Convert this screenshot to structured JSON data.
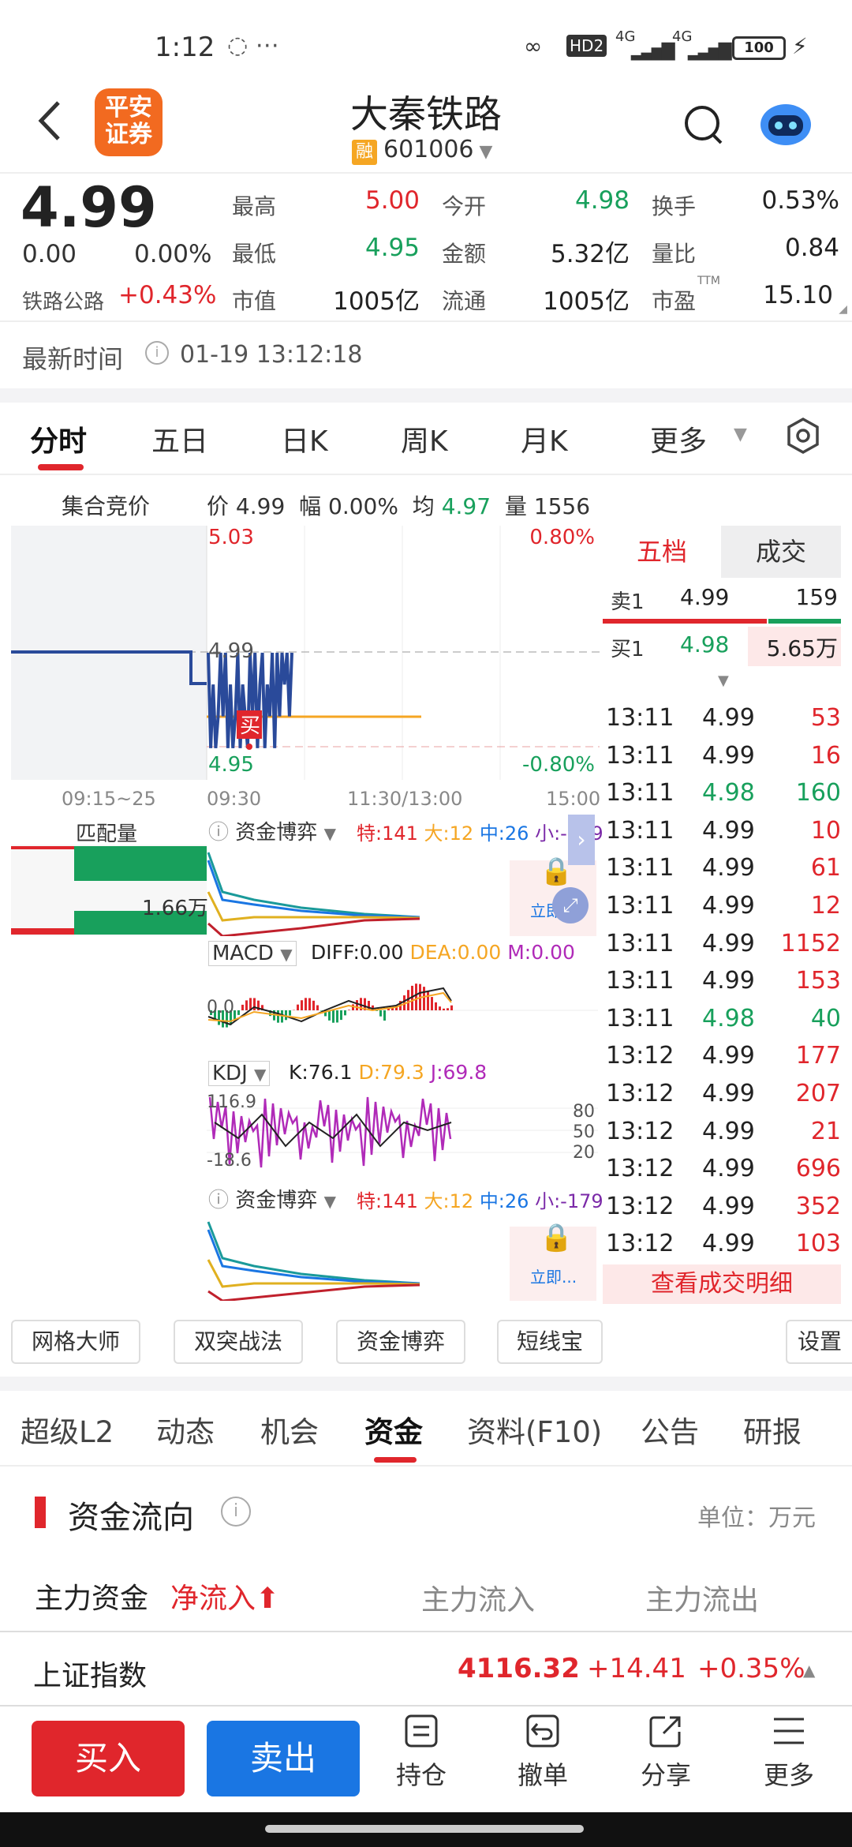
{
  "status": {
    "time": "1:12",
    "sig1": "4G",
    "sig2": "4G",
    "battery": "100",
    "hd": "HD2"
  },
  "header": {
    "title": "大秦铁路",
    "code": "601006",
    "rong": "融",
    "logo_line1": "平安",
    "logo_line2": "证券"
  },
  "quote": {
    "price": "4.99",
    "change": "0.00",
    "change_pct": "0.00%",
    "sector": "铁路公路",
    "sector_pct": "+0.43%",
    "high_label": "最高",
    "high": "5.00",
    "open_label": "今开",
    "open": "4.98",
    "turnover_label": "换手",
    "turnover": "0.53%",
    "low_label": "最低",
    "low": "4.95",
    "amount_label": "金额",
    "amount": "5.32亿",
    "volratio_label": "量比",
    "volratio": "0.84",
    "mcap_label": "市值",
    "mcap": "1005亿",
    "float_label": "流通",
    "float": "1005亿",
    "pe_label": "市盈",
    "pe_sup": "TTM",
    "pe": "15.10"
  },
  "updated": {
    "label": "最新时间",
    "value": "01-19 13:12:18"
  },
  "charttabs": [
    "分时",
    "五日",
    "日K",
    "周K",
    "月K",
    "更多"
  ],
  "infobar": {
    "auction": "集合竞价",
    "price_label": "价",
    "price": "4.99",
    "amp_label": "幅",
    "amp": "0.00%",
    "avg_label": "均",
    "avg": "4.97",
    "vol_label": "量",
    "vol": "1556"
  },
  "chart_data": {
    "type": "line",
    "title": "",
    "x_ticks": [
      "09:15~25",
      "09:30",
      "11:30/13:00",
      "15:00"
    ],
    "ylim": [
      4.95,
      5.03
    ],
    "y_top": "5.03",
    "y_bottom": "4.95",
    "pct_top": "0.80%",
    "pct_bottom": "-0.80%",
    "prev_close": "4.99",
    "series": [
      {
        "name": "",
        "values": [
          4.99,
          4.96,
          4.98,
          4.96,
          4.97,
          4.99,
          4.97,
          4.99,
          4.96,
          4.98,
          4.96,
          4.97,
          4.99,
          4.96,
          4.98,
          4.97,
          4.96,
          4.99,
          4.97,
          4.99,
          4.96,
          4.98,
          4.99,
          4.96,
          4.98,
          4.97,
          4.99,
          4.96,
          4.99,
          4.97,
          4.99,
          4.98,
          4.99,
          4.97,
          4.99
        ]
      }
    ]
  },
  "buy_marker": "买",
  "match_label": "匹配量",
  "match_value": "1.66万",
  "ind1": {
    "name": "资金博弈",
    "te": "特:141",
    "da": "大:12",
    "zhong": "中:26",
    "xiao": "小:-179",
    "lock": "立即..."
  },
  "macd": {
    "name": "MACD",
    "diff": "DIFF:0.00",
    "dea": "DEA:0.00",
    "m": "M:0.00",
    "zero": "0.0"
  },
  "kdj": {
    "name": "KDJ",
    "k": "K:76.1",
    "d": "D:79.3",
    "j": "J:69.8",
    "l80": "80",
    "l50": "50",
    "l20": "20",
    "top": "116.9",
    "bot": "-18.6"
  },
  "orderbook": {
    "tab1": "五档",
    "tab2": "成交",
    "sell1_label": "卖1",
    "sell1_price": "4.99",
    "sell1_vol": "159",
    "buy1_label": "买1",
    "buy1_price": "4.98",
    "buy1_vol": "5.65万"
  },
  "trades": [
    {
      "t": "13:11",
      "p": "4.99",
      "v": "53",
      "pc": "b",
      "vc": "r"
    },
    {
      "t": "13:11",
      "p": "4.99",
      "v": "16",
      "pc": "b",
      "vc": "r"
    },
    {
      "t": "13:11",
      "p": "4.98",
      "v": "160",
      "pc": "g",
      "vc": "g"
    },
    {
      "t": "13:11",
      "p": "4.99",
      "v": "10",
      "pc": "b",
      "vc": "r"
    },
    {
      "t": "13:11",
      "p": "4.99",
      "v": "61",
      "pc": "b",
      "vc": "r"
    },
    {
      "t": "13:11",
      "p": "4.99",
      "v": "12",
      "pc": "b",
      "vc": "r"
    },
    {
      "t": "13:11",
      "p": "4.99",
      "v": "1152",
      "pc": "b",
      "vc": "r"
    },
    {
      "t": "13:11",
      "p": "4.99",
      "v": "153",
      "pc": "b",
      "vc": "r"
    },
    {
      "t": "13:11",
      "p": "4.98",
      "v": "40",
      "pc": "g",
      "vc": "g"
    },
    {
      "t": "13:12",
      "p": "4.99",
      "v": "177",
      "pc": "b",
      "vc": "r"
    },
    {
      "t": "13:12",
      "p": "4.99",
      "v": "207",
      "pc": "b",
      "vc": "r"
    },
    {
      "t": "13:12",
      "p": "4.99",
      "v": "21",
      "pc": "b",
      "vc": "r"
    },
    {
      "t": "13:12",
      "p": "4.99",
      "v": "696",
      "pc": "b",
      "vc": "r"
    },
    {
      "t": "13:12",
      "p": "4.99",
      "v": "352",
      "pc": "b",
      "vc": "r"
    },
    {
      "t": "13:12",
      "p": "4.99",
      "v": "103",
      "pc": "b",
      "vc": "r"
    }
  ],
  "trade_detail": "查看成交明细",
  "tools": [
    "网格大师",
    "双突战法",
    "资金博弈",
    "短线宝",
    "设置"
  ],
  "navtabs": [
    "超级L2",
    "动态",
    "机会",
    "资金",
    "资料(F10)",
    "公告",
    "研报"
  ],
  "fundflow": {
    "title": "资金流向",
    "unit": "单位：万元",
    "main_label": "主力资金",
    "net_label": "净流入",
    "in_label": "主力流入",
    "out_label": "主力流出"
  },
  "index": {
    "name": "上证指数",
    "value": "4116.32",
    "change": "+14.41",
    "pct": "+0.35%"
  },
  "bottom": {
    "buy": "买入",
    "sell": "卖出",
    "hold": "持仓",
    "cancel": "撤单",
    "share": "分享",
    "more": "更多"
  },
  "colors": {
    "red": "#e0262c",
    "green": "#18a05c",
    "blue": "#1a76e3",
    "orange": "#f26a20",
    "line": "#2a4a9a",
    "avg": "#f5a623"
  }
}
